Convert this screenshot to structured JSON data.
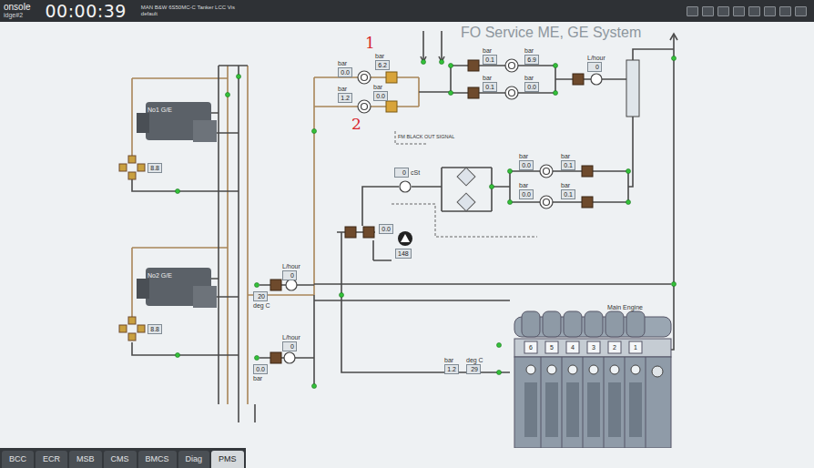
{
  "header": {
    "app": "onsole",
    "station": "idge#2",
    "clock": "00:00:39",
    "model": "MAN B&W 6S50MC-C Tanker LCC Vis",
    "profile": "default"
  },
  "diagram": {
    "title": "FO Service ME, GE System",
    "annotations": [
      "1",
      "2"
    ],
    "signal": "FM BLACK OUT SIGNAL",
    "engines": [
      "No1 G/E",
      "No2 G/E"
    ],
    "main_engine": {
      "label": "Main Engine",
      "cylinders": [
        "6",
        "5",
        "4",
        "3",
        "2",
        "1"
      ]
    },
    "gauges": [
      {
        "unit": "bar",
        "value": "0.0",
        "kind": "stack"
      },
      {
        "unit": "bar",
        "value": "6.2",
        "kind": "stack"
      },
      {
        "unit": "bar",
        "value": "1.2",
        "kind": "stack"
      },
      {
        "unit": "bar",
        "value": "0.0",
        "kind": "stack"
      },
      {
        "unit": "bar",
        "value": "0.1",
        "kind": "stack"
      },
      {
        "unit": "bar",
        "value": "6.9",
        "kind": "stack"
      },
      {
        "unit": "bar",
        "value": "0.1",
        "kind": "stack"
      },
      {
        "unit": "bar",
        "value": "0.0",
        "kind": "stack"
      },
      {
        "unit": "L/hour",
        "value": "0",
        "kind": "stack"
      },
      {
        "unit": "cSt",
        "value": "0",
        "kind": "inline"
      },
      {
        "unit": "bar",
        "value": "0.0",
        "kind": "stack"
      },
      {
        "unit": "bar",
        "value": "0.1",
        "kind": "stack"
      },
      {
        "unit": "bar",
        "value": "0.0",
        "kind": "stack"
      },
      {
        "unit": "bar",
        "value": "0.1",
        "kind": "stack"
      },
      {
        "value": "0.0",
        "kind": "box"
      },
      {
        "value": "148",
        "kind": "box"
      },
      {
        "value": "8.8",
        "kind": "box"
      },
      {
        "value": "8.8",
        "kind": "box"
      },
      {
        "unit": "L/hour",
        "value": "0",
        "kind": "stack"
      },
      {
        "unit": "deg C",
        "value": "20",
        "kind": "value-first"
      },
      {
        "unit": "L/hour",
        "value": "0",
        "kind": "stack"
      },
      {
        "unit": "bar",
        "value": "0.0",
        "kind": "value-first"
      },
      {
        "unit": "bar",
        "value": "1.2",
        "kind": "stack"
      },
      {
        "unit": "deg C",
        "value": "29",
        "kind": "stack"
      }
    ]
  },
  "tabs": [
    {
      "label": "BCC",
      "selected": false
    },
    {
      "label": "ECR",
      "selected": false
    },
    {
      "label": "MSB",
      "selected": false
    },
    {
      "label": "CMS",
      "selected": false
    },
    {
      "label": "BMCS",
      "selected": false
    },
    {
      "label": "Diag",
      "selected": false
    },
    {
      "label": "PMS",
      "selected": true
    }
  ]
}
